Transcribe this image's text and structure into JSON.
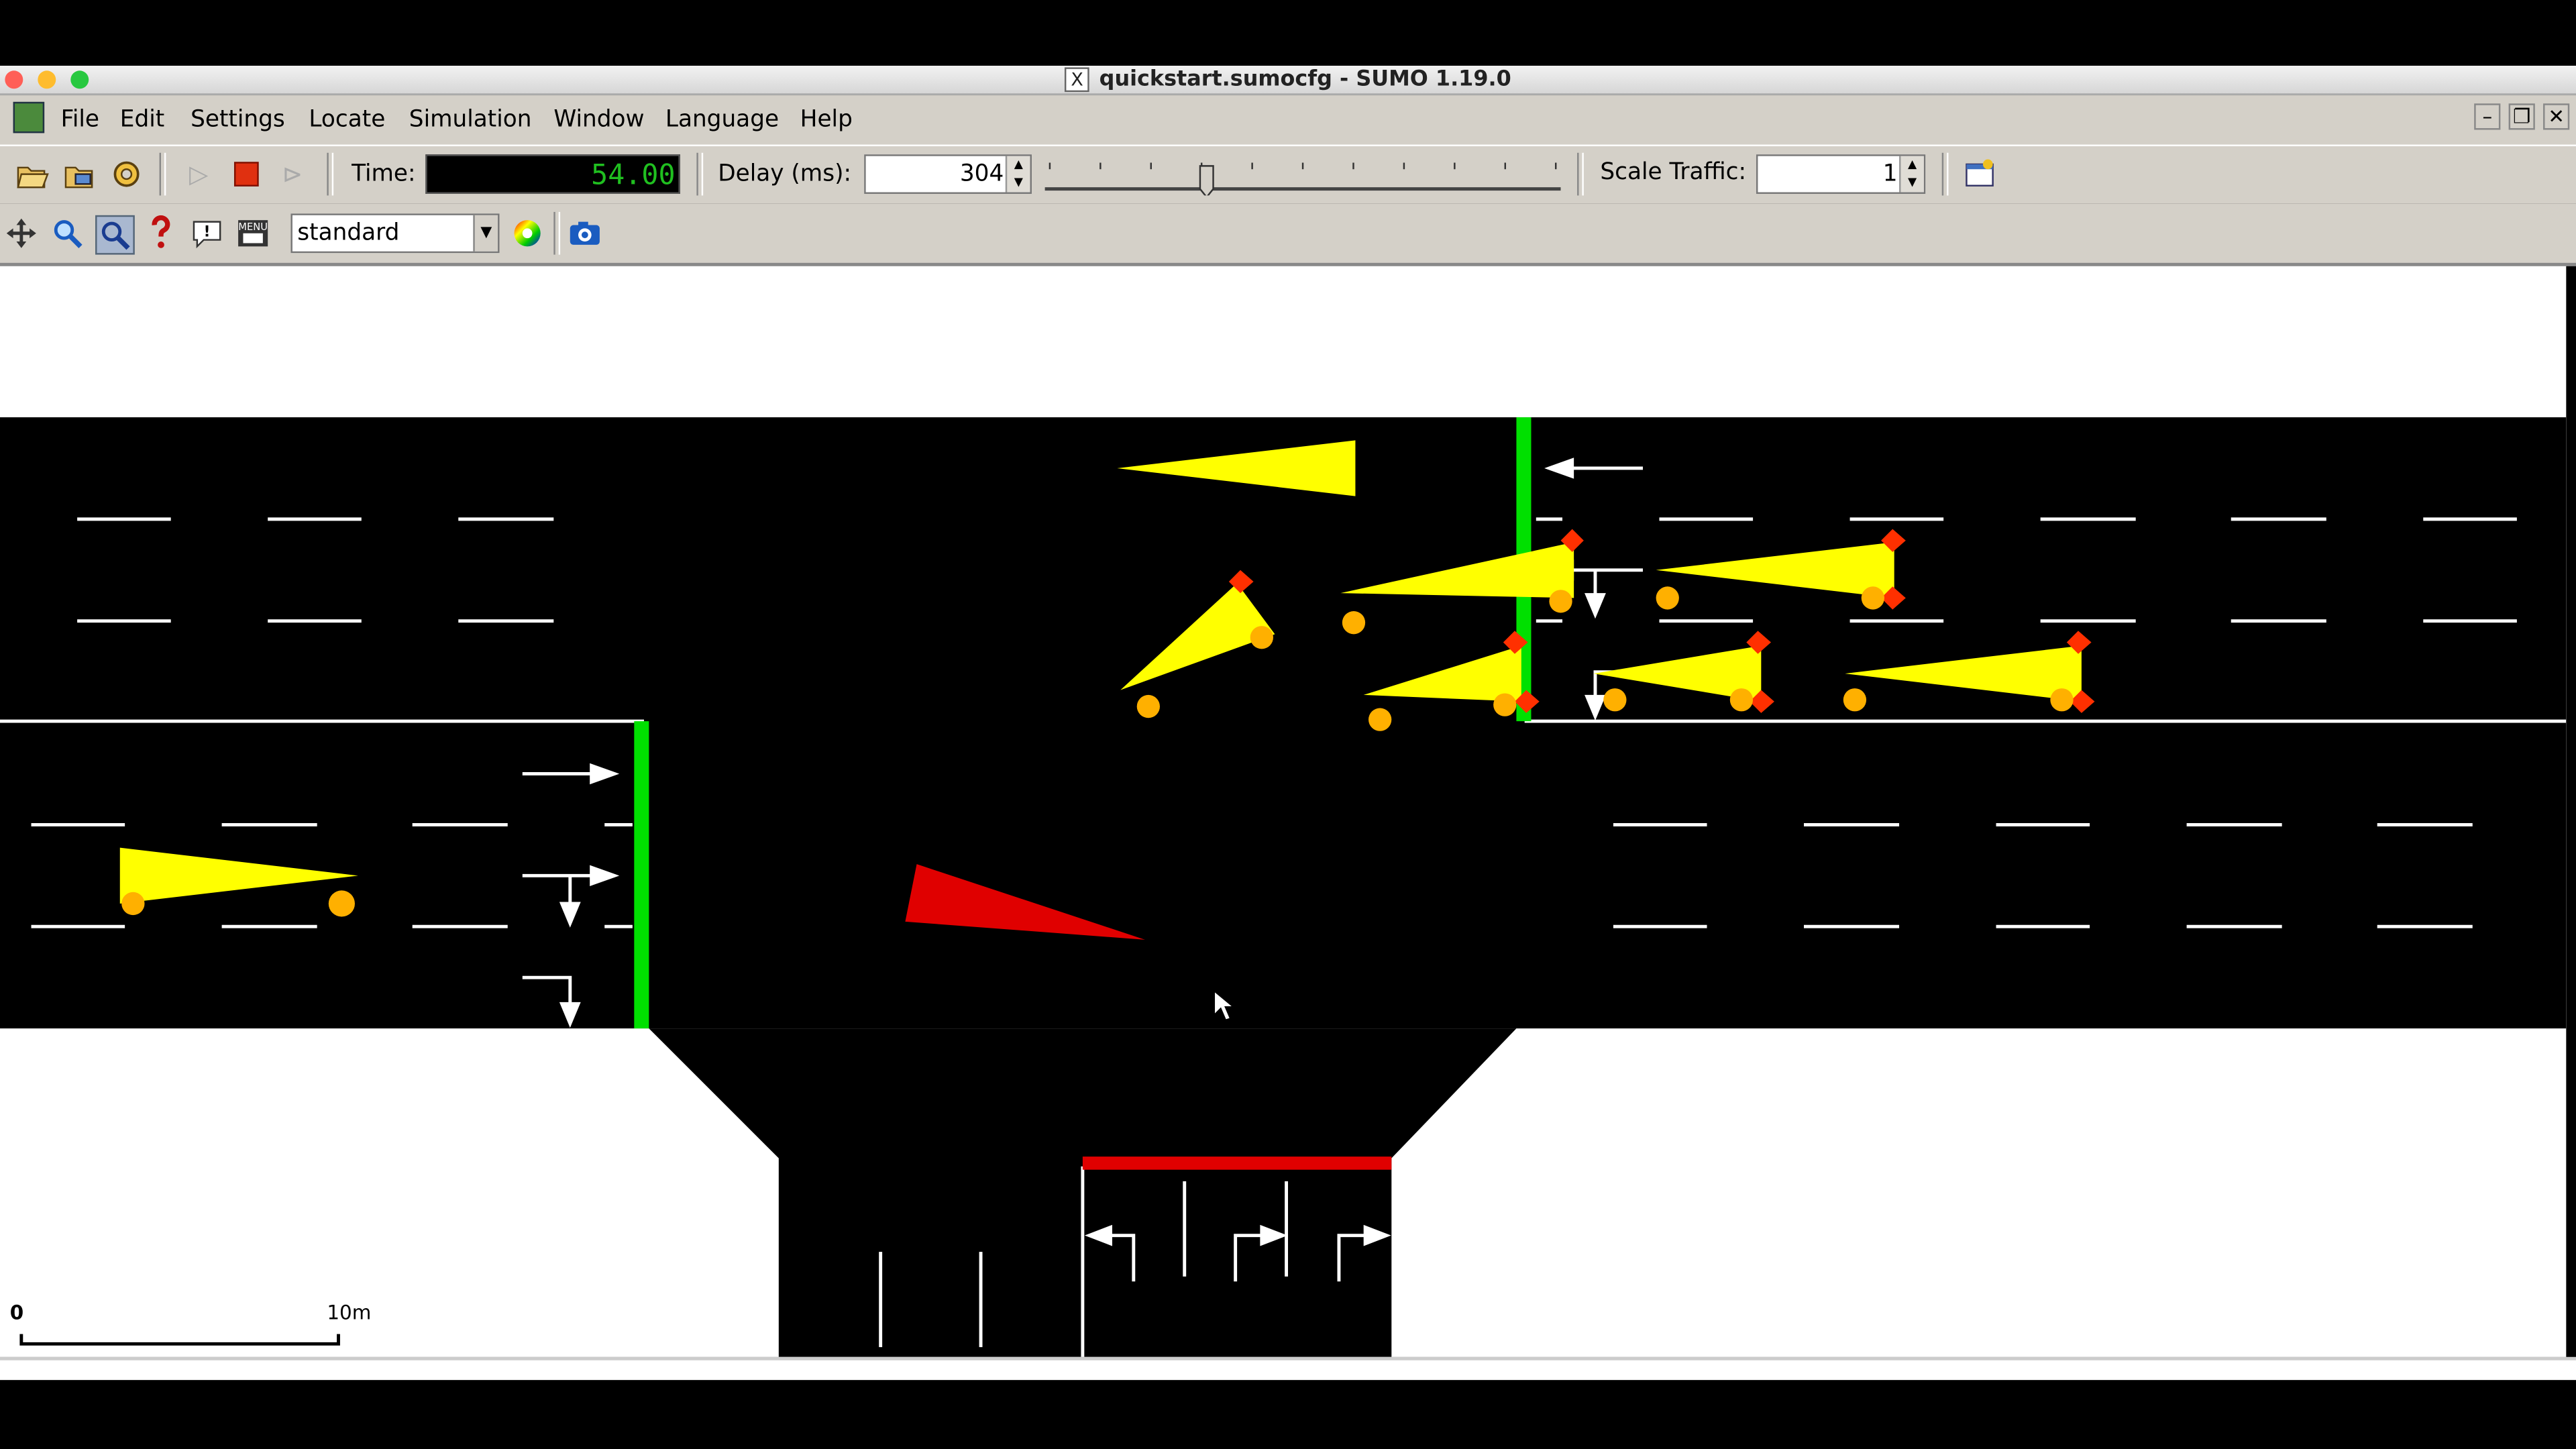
{
  "window": {
    "title": "quickstart.sumocfg - SUMO 1.19.0",
    "xicon": "X"
  },
  "menu": {
    "items": [
      "File",
      "Edit",
      "Settings",
      "Locate",
      "Simulation",
      "Window",
      "Language",
      "Help"
    ]
  },
  "toolbar": {
    "time_label": "Time:",
    "time_value": "54.00",
    "delay_label": "Delay (ms):",
    "delay_value": "304",
    "scale_label": "Scale Traffic:",
    "scale_value": "1",
    "delay_slider_fraction": 0.31
  },
  "view": {
    "scheme": "standard"
  },
  "scalebar": {
    "start": "0",
    "end": "10m"
  },
  "colors": {
    "vehicle": "#ffff00",
    "selected_vehicle": "#e00000",
    "light_green": "#00e000",
    "light_red": "#e00000",
    "road": "#000000",
    "marking": "#ffffff"
  }
}
